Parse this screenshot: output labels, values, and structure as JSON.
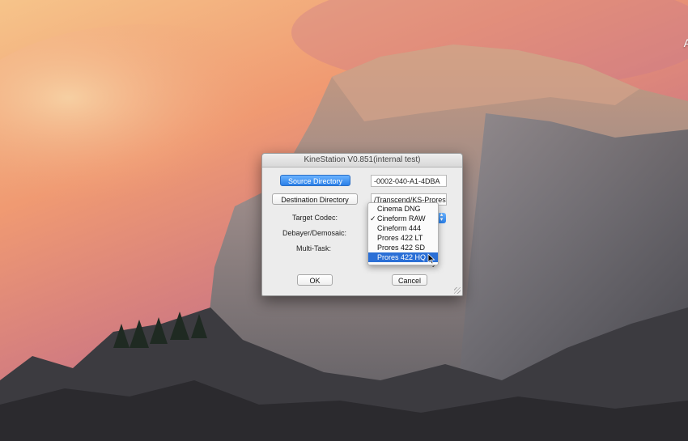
{
  "dialog": {
    "title": "KineStation V0.851(internal test)",
    "source_button": "Source Directory",
    "source_value": "-0002-040-A1-4DBA",
    "destination_button": "Destination Directory",
    "destination_value": "/Transcend/KS-Prores",
    "target_codec_label": "Target Codec:",
    "debayer_label": "Debayer/Demosaic:",
    "multitask_label": "Multi-Task:",
    "directory_checkbox_label": "ctory",
    "ok_button": "OK",
    "cancel_button": "Cancel"
  },
  "codec_menu": {
    "items": [
      {
        "label": "Cinema DNG",
        "checked": false,
        "highlighted": false
      },
      {
        "label": "Cineform RAW",
        "checked": true,
        "highlighted": false
      },
      {
        "label": "Cineform 444",
        "checked": false,
        "highlighted": false
      },
      {
        "label": "Prores 422 LT",
        "checked": false,
        "highlighted": false
      },
      {
        "label": "Prores 422 SD",
        "checked": false,
        "highlighted": false
      },
      {
        "label": "Prores 422 HQ",
        "checked": false,
        "highlighted": true
      }
    ]
  },
  "desktop": {
    "corner_text": "A"
  },
  "colors": {
    "accent": "#2a6fd6",
    "primary_button": "#2a7fe8"
  }
}
